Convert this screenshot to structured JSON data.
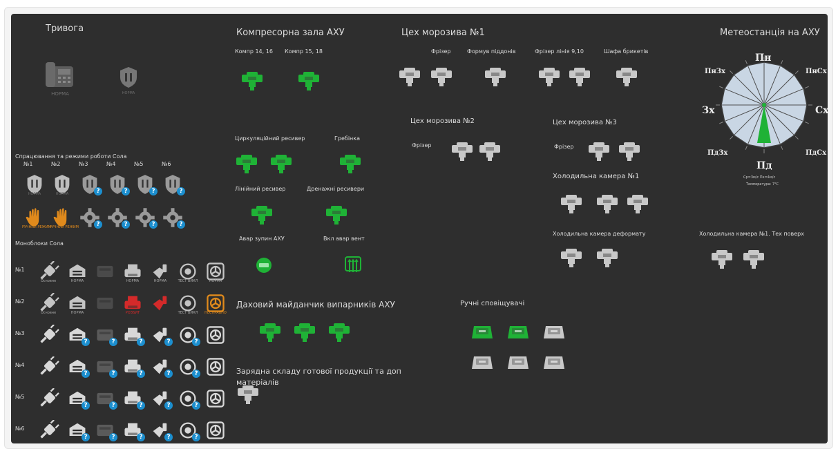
{
  "alarm": {
    "title": "Тривога",
    "phone_status": "НОРМА",
    "shield_status": "НОРМА"
  },
  "compressor": {
    "title": "Компресорна зала АХУ",
    "group1_label": "Компр 14, 16",
    "group2_label": "Компр 15, 18",
    "circ_receiver_label": "Циркуляційний ресивер",
    "comb_label": "Гребінка",
    "line_receiver_label": "Лінійний ресивер",
    "drain_receivers_label": "Дренажні ресивери",
    "emergency_stop_label": "Авар зупин АХУ",
    "emergency_vent_label": "Вкл авар вент",
    "roof_title": "Даховий майданчик випарників АХУ",
    "charging_title": "Зарядна складу готової продукції та доп матеріалів"
  },
  "icecream1": {
    "title": "Цех морозива №1",
    "freezer_label": "Фрізер",
    "tray_former_label": "Формув піддонів",
    "freezer_line_label": "Фрізер лінія 9,10",
    "briquette_cabinet_label": "Шафа брикетів"
  },
  "icecream2": {
    "title": "Цех морозива №2",
    "freezer_label": "Фрізер"
  },
  "icecream3": {
    "title": "Цех морозива №3",
    "freezer_label": "Фрізер"
  },
  "cold1": {
    "title": "Холодильна камера №1"
  },
  "cold_deformat": {
    "title": "Холодильна камера деформату"
  },
  "cold1_tech": {
    "title": "Холодильна камера №1. Тех поверх"
  },
  "manual": {
    "title": "Ручні сповіщувачі"
  },
  "weather": {
    "title": "Метеостанція на АХУ",
    "dir_n": "Пн",
    "dir_ne": "ПнСх",
    "dir_e": "Сх",
    "dir_se": "ПдСх",
    "dir_s": "Пд",
    "dir_sw": "ПдЗх",
    "dir_w": "Зх",
    "dir_nw": "ПнЗх",
    "speed_line": "Ср=3м/с Пк=4м/с",
    "temp_line": "Температура: 7°С",
    "wind_direction": "Пд"
  },
  "salt": {
    "title": "Спрацювання та режими роботи Сола",
    "cols": [
      "№1",
      "№2",
      "№3",
      "№4",
      "№5",
      "№6"
    ],
    "row1_status": "НОРМА",
    "hand_status": "РУЧНИЙ РЕЖИМ"
  },
  "monoblocks": {
    "title": "Моноблоки Сола",
    "rows": [
      "№1",
      "№2",
      "№3",
      "№4",
      "№5",
      "№6"
    ],
    "r1": [
      "Основне",
      "НОРМА",
      "",
      "НОРМА",
      "НОРМА",
      "ТЕСТ ВИКЛ",
      "НОРМА"
    ],
    "r2": [
      "Основне",
      "НОРМА",
      "",
      "РОЗБИТ",
      "",
      "ТЕСТ ВИКЛ",
      "НЕСПРАВНО"
    ]
  },
  "colors": {
    "green": "#1fb236",
    "gray_device": "#c8c8c8",
    "warn": "#e08a1c",
    "red": "#d42a2a",
    "badge": "#1c8fcf"
  }
}
